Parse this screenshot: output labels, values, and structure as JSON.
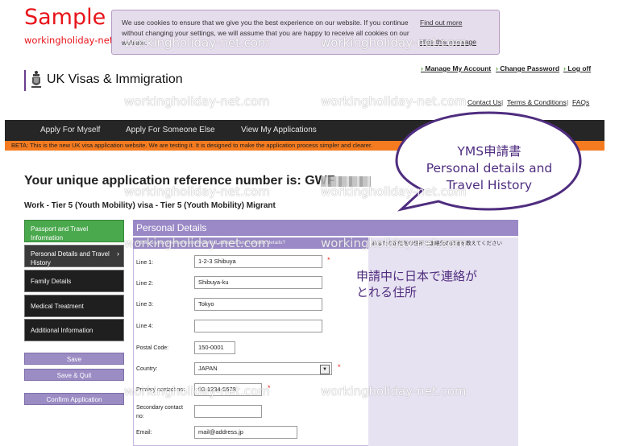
{
  "overlay": {
    "sample_title": "Sample",
    "sample_site": "workingholiday-net.com",
    "watermark_text": "workingholiday-net.com"
  },
  "cookie": {
    "message": "We use cookies to ensure that we give you the best experience on our website. If you continue without changing your settings, we will assume that you are happy to receive all cookies on our website.",
    "find_out_more": "Find out more",
    "hide_message": "Hide this message"
  },
  "header": {
    "site_name": "UK Visas & Immigration",
    "account_links": [
      "Manage My Account",
      "Change Password",
      "Log off"
    ],
    "secondary_links": [
      "Contact Us",
      "Terms & Conditions",
      "FAQs"
    ]
  },
  "nav": {
    "items": [
      "Apply For Myself",
      "Apply For Someone Else",
      "View My Applications"
    ]
  },
  "beta_banner": "BETA: This is the new UK visa application website. We are testing it. It is designed to make the application process simpler and clearer.",
  "reference": {
    "label": "Your unique application reference number is: GWF"
  },
  "visa_type": "Work - Tier 5 (Youth Mobility) visa - Tier 5 (Youth Mobility) Migrant",
  "sidebar": {
    "items": [
      "Passport and Travel Information",
      "Personal Details and Travel History",
      "Family Details",
      "Medical Treatment",
      "Additional Information"
    ],
    "buttons": [
      "Save",
      "Save & Quit",
      "Confirm Application"
    ]
  },
  "section": {
    "title": "Personal Details",
    "question": "What is your permanent residential address and contact details?",
    "jp_question_note": "あなたの定住地の住所と連絡先の詳細を教えてください"
  },
  "form": {
    "fields": [
      {
        "label": "Line 1:",
        "value": "1-2-3 Shibuya"
      },
      {
        "label": "Line 2:",
        "value": "Shibuya-ku"
      },
      {
        "label": "Line 3:",
        "value": "Tokyo"
      },
      {
        "label": "Line 4:",
        "value": ""
      },
      {
        "label": "Postal Code:",
        "value": "150-0001"
      },
      {
        "label": "Country:",
        "value": "JAPAN"
      },
      {
        "label": "Primary contact no:",
        "value": "03-1234-5678"
      },
      {
        "label": "Secondary contact no:",
        "value": ""
      },
      {
        "label": "Email:",
        "value": "mail@address.jp"
      }
    ]
  },
  "annotations": {
    "bubble_line1": "YMS申請書",
    "bubble_line2": "Personal details and",
    "bubble_line3": "Travel History",
    "callout_line1": "申請中に日本で連絡が",
    "callout_line2": "とれる住所"
  },
  "colors": {
    "sample_red": "#e8141b",
    "brand_purple": "#6c3d8e",
    "nav_dark": "#262626",
    "beta_orange": "#f47b20",
    "side_green": "#4aa84d",
    "button_lilac": "#9b8cc4",
    "annotation_purple": "#4f2d7f"
  },
  "icons": {
    "crest": "royal-crest-icon",
    "link": "chevron-right-icon",
    "select": "dropdown-arrow-icon"
  }
}
